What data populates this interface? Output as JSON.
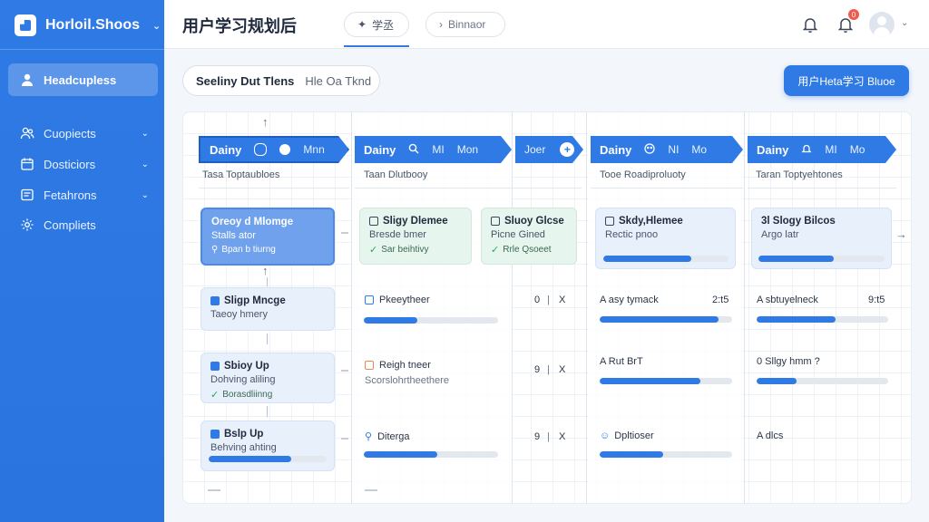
{
  "sidebar": {
    "brand": "Horloil.Shoos",
    "active": "Headcupless",
    "items": [
      {
        "label": "Cuopiects",
        "icon": "users-icon"
      },
      {
        "label": "Dosticiors",
        "icon": "calendar-icon"
      },
      {
        "label": "Fetahrons",
        "icon": "list-icon"
      },
      {
        "label": "Compliets",
        "icon": "gear-icon"
      }
    ]
  },
  "header": {
    "title": "用户学习规划后",
    "tab1": "学丞",
    "tab2": "Binnaor",
    "badge": "0"
  },
  "toolbar": {
    "filter_bold": "Seeliny Dut Tlens",
    "filter_sub": "Hle Oa Tknd",
    "primary_button": "用户Heta学习 Bluoe"
  },
  "stages": [
    {
      "label": "Dainy",
      "m": "Mnn"
    },
    {
      "label": "Dainy",
      "a": "MI",
      "m": "Mon"
    },
    {
      "label": "Joer"
    },
    {
      "label": "Dainy",
      "a": "NI",
      "m": "Mo"
    },
    {
      "label": "Dainy",
      "a": "MI",
      "m": "Mo"
    }
  ],
  "columns": [
    {
      "sub": "Tasa Toptaubloes"
    },
    {
      "sub": "Taan Dlutbooy"
    },
    {
      "sub": "Tooe Roadiproluoty"
    },
    {
      "sub": "Taran Toptyehtones"
    }
  ],
  "col1": {
    "card1": {
      "title": "Oreoy d Mlomge",
      "desc": "Stalls ator",
      "tag": "Bpan b tiurng"
    },
    "card2": {
      "title": "Sligp Mncge",
      "desc": "Taeoy hmery"
    },
    "card3": {
      "title": "Sbioy Up",
      "desc": "Dohving aliling",
      "tag": "Borasdliinng"
    },
    "card4": {
      "title": "Bslp Up",
      "desc": "Behving ahting",
      "progress": 0.7
    }
  },
  "col2": {
    "card1": {
      "title": "Sligy Dlemee",
      "desc": "Bresde bmer",
      "tag": "Sar beihtivy"
    },
    "card1b": {
      "title": "Sluoy Glcse",
      "desc": "Picne Gined",
      "tag": "Rrle Qsoeet"
    },
    "row1": {
      "title": "Pkeeytheer",
      "count": "0",
      "mark": "X",
      "progress": 0.4
    },
    "row2": {
      "title": "Reigh tneer",
      "desc": "Scorslohrtheethere",
      "count": "9",
      "mark": "X"
    },
    "row3": {
      "title": "Diterga",
      "count": "9",
      "mark": "X",
      "progress": 0.55
    }
  },
  "col3": {
    "card1": {
      "title": "Skdy,Hlemee",
      "desc": "Rectic pnoo",
      "progress": 0.7
    },
    "row1": {
      "title": "A asy tymack",
      "val": "2:t5",
      "progress": 0.9
    },
    "row2": {
      "title": "A Rut BrT",
      "progress": 0.76
    },
    "row3": {
      "title": "Dpltioser",
      "progress": 0.48
    }
  },
  "col4": {
    "card1": {
      "title": "3l Slogy Bilcos",
      "desc": "Argo latr",
      "progress": 0.6
    },
    "row1": {
      "title": "A sbtuyelneck",
      "val": "9:t5",
      "progress": 0.6
    },
    "row2": {
      "title": "0 Sllgy hmm ?",
      "progress": 0.3
    },
    "row3": {
      "title": "A dlcs"
    }
  },
  "colors": {
    "accent": "#2f7ae5",
    "sidebar": "#2f7ae5",
    "green": "#e6f5ee",
    "badge": "#f05a4f"
  }
}
